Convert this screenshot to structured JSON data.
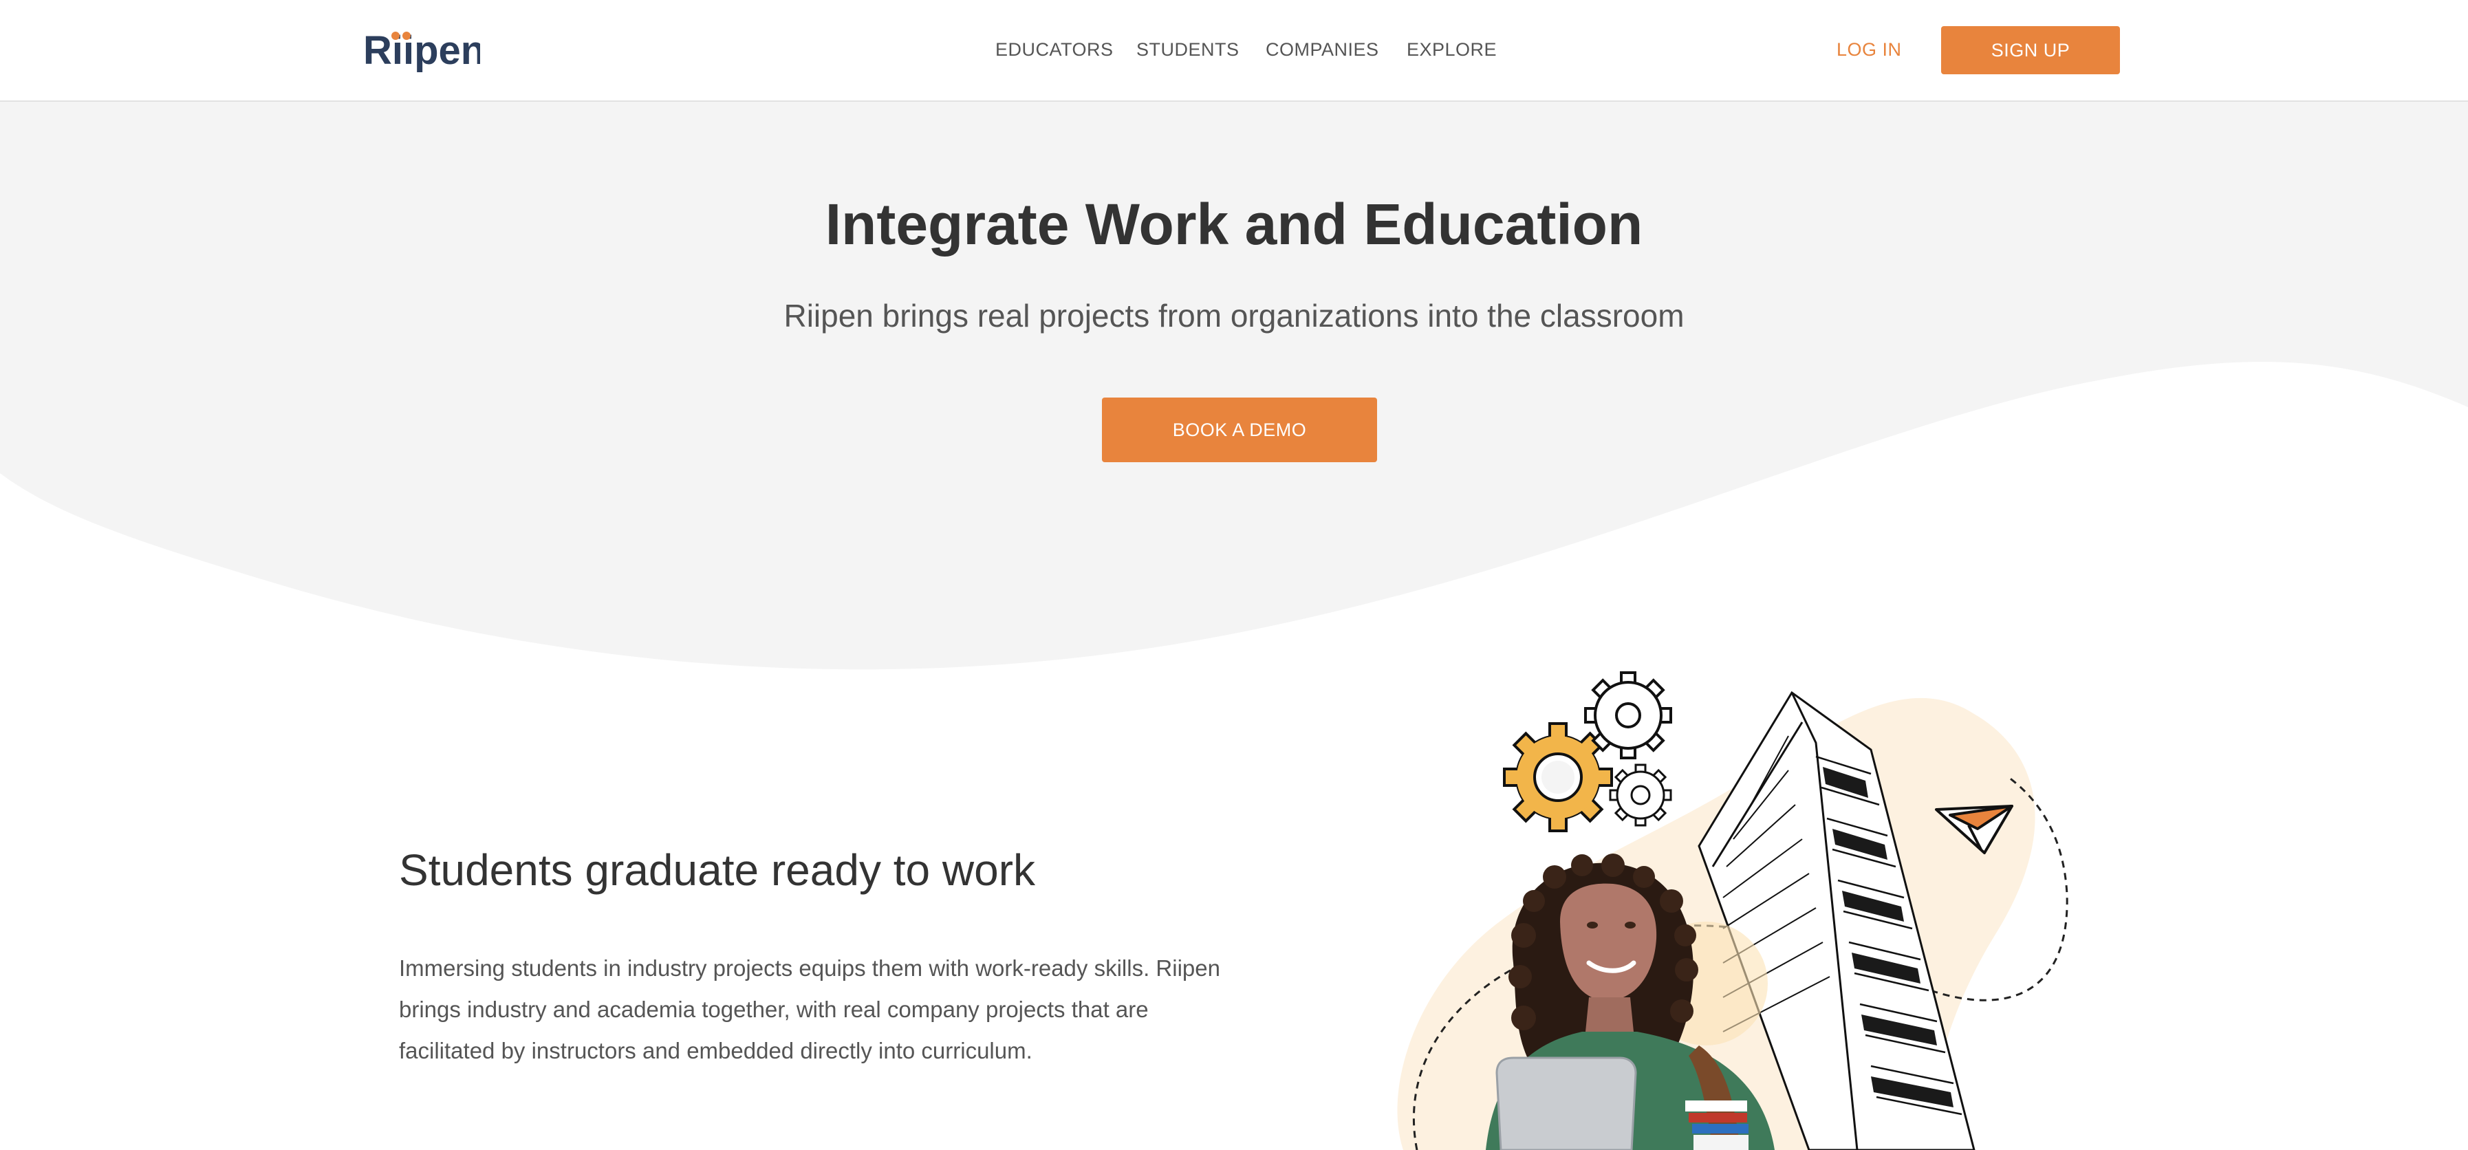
{
  "header": {
    "logo_text": "Riipen",
    "nav": [
      "EDUCATORS",
      "STUDENTS",
      "COMPANIES",
      "EXPLORE"
    ],
    "login_label": "LOG IN",
    "signup_label": "SIGN UP"
  },
  "hero": {
    "title": "Integrate Work and Education",
    "subtitle": "Riipen brings real projects from organizations into the classroom",
    "cta_label": "BOOK A DEMO"
  },
  "feature": {
    "title": "Students graduate ready to work",
    "body": "Immersing students in industry projects equips them with work-ready skills. Riipen brings industry and academia together, with real company projects that are facilitated by instructors and embedded directly into curriculum."
  },
  "colors": {
    "accent": "#e8843d",
    "logo_dark": "#2c3e5c",
    "hero_background": "#f4f4f4",
    "illustration_blob": "#fdf1e0",
    "gear_yellow": "#f2b54a"
  },
  "icons": [
    "gear-icon",
    "paper-plane-icon"
  ]
}
